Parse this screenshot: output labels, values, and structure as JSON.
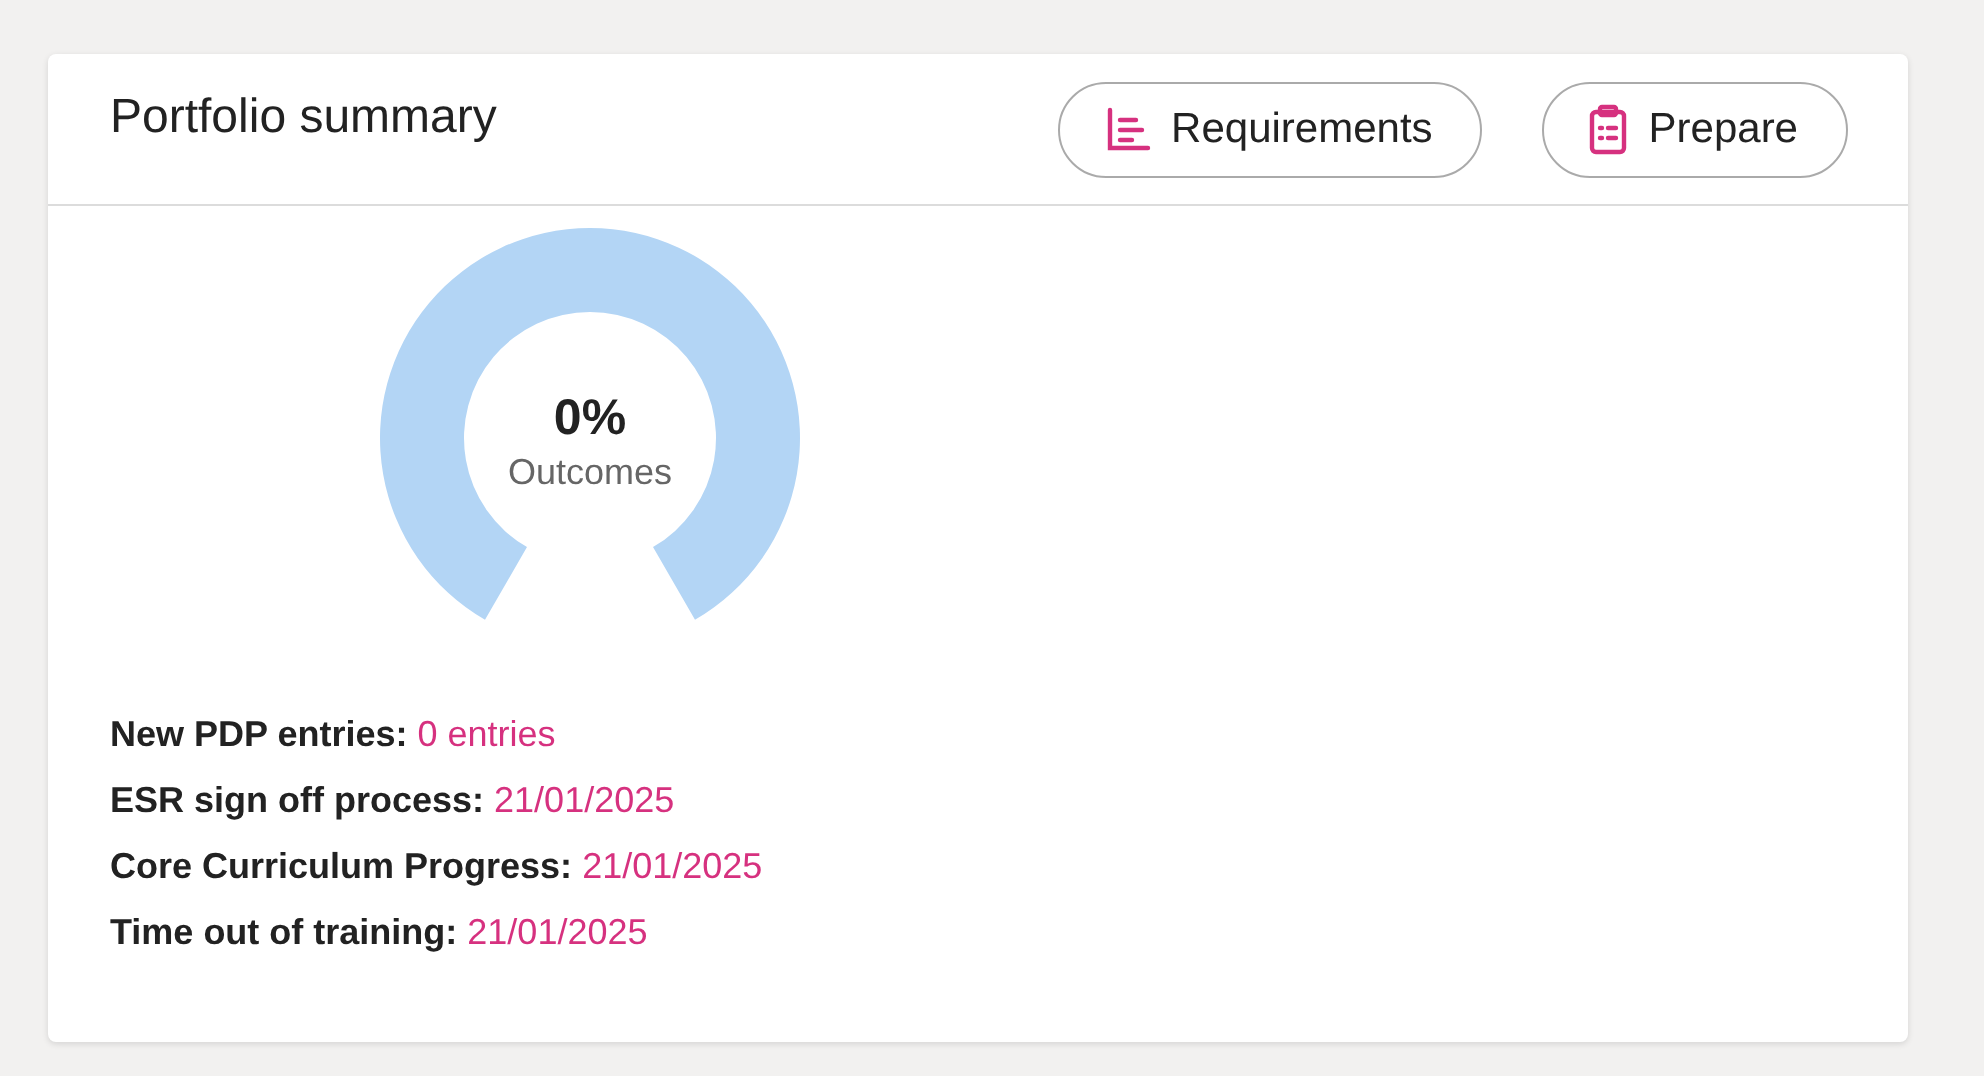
{
  "card": {
    "title": "Portfolio summary",
    "buttons": [
      {
        "label": "Requirements"
      },
      {
        "label": "Prepare"
      }
    ],
    "gauge": {
      "value": "0%",
      "caption": "Outcomes"
    },
    "details": [
      {
        "label": "New PDP entries:",
        "value": "0 entries"
      },
      {
        "label": "ESR sign off process:",
        "value": "21/01/2025"
      },
      {
        "label": "Core Curriculum Progress:",
        "value": "21/01/2025"
      },
      {
        "label": "Time out of training:",
        "value": "21/01/2025"
      }
    ]
  }
}
